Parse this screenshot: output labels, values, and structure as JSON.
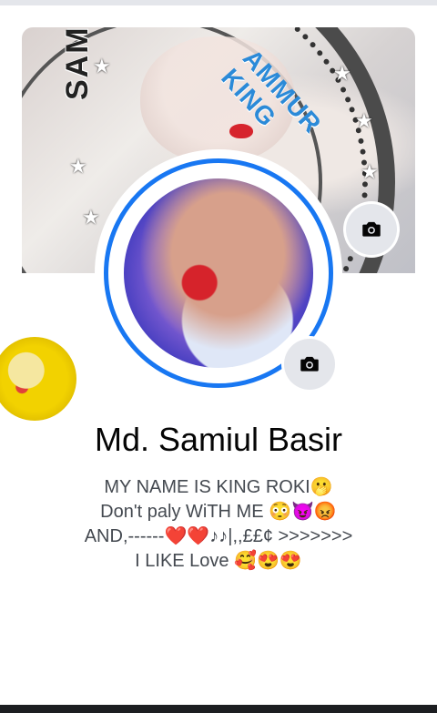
{
  "profile": {
    "name": "Md. Samiul Basir",
    "bio_lines": [
      "MY NAME IS KING ROKI🫢",
      "Don't paly WiTH ME 😳😈😡",
      "AND,------❤️❤️♪♪|,,££¢ >>>>>>>",
      "I LIKE Love 🥰😍😍"
    ]
  },
  "cover": {
    "text_left": "SAMIUL",
    "text_right": "AMMUR KING"
  },
  "icons": {
    "cover_camera": "camera-icon",
    "profile_camera": "camera-icon"
  },
  "colors": {
    "accent": "#1877f2",
    "button_bg": "#e4e6eb",
    "name_text": "#050505",
    "bio_text": "#444950"
  }
}
